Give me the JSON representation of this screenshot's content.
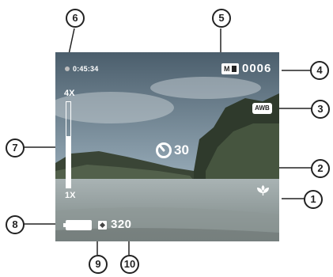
{
  "preview": {
    "timer": "0:45:34",
    "counter": "0006",
    "mode_label": "M",
    "awb_label": "AWB",
    "zoom_max": "4X",
    "zoom_min": "1X",
    "zoom_level_fraction": 0.6,
    "self_timer": "30",
    "resolution": "320",
    "icons": [
      "record-dot-icon",
      "mode-icon",
      "awb-icon",
      "zoom-bar",
      "self-timer-icon",
      "macro-flower-icon",
      "battery-icon",
      "quality-icon"
    ]
  },
  "callouts": [
    "1",
    "2",
    "3",
    "4",
    "5",
    "6",
    "7",
    "8",
    "9",
    "10"
  ]
}
